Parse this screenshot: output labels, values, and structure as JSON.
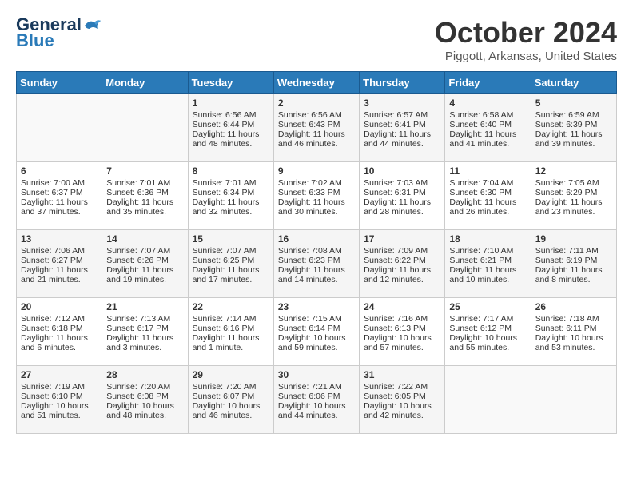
{
  "header": {
    "logo_line1": "General",
    "logo_line2": "Blue",
    "month": "October 2024",
    "location": "Piggott, Arkansas, United States"
  },
  "weekdays": [
    "Sunday",
    "Monday",
    "Tuesday",
    "Wednesday",
    "Thursday",
    "Friday",
    "Saturday"
  ],
  "weeks": [
    [
      {
        "day": "",
        "info": ""
      },
      {
        "day": "",
        "info": ""
      },
      {
        "day": "1",
        "info": "Sunrise: 6:56 AM\nSunset: 6:44 PM\nDaylight: 11 hours and 48 minutes."
      },
      {
        "day": "2",
        "info": "Sunrise: 6:56 AM\nSunset: 6:43 PM\nDaylight: 11 hours and 46 minutes."
      },
      {
        "day": "3",
        "info": "Sunrise: 6:57 AM\nSunset: 6:41 PM\nDaylight: 11 hours and 44 minutes."
      },
      {
        "day": "4",
        "info": "Sunrise: 6:58 AM\nSunset: 6:40 PM\nDaylight: 11 hours and 41 minutes."
      },
      {
        "day": "5",
        "info": "Sunrise: 6:59 AM\nSunset: 6:39 PM\nDaylight: 11 hours and 39 minutes."
      }
    ],
    [
      {
        "day": "6",
        "info": "Sunrise: 7:00 AM\nSunset: 6:37 PM\nDaylight: 11 hours and 37 minutes."
      },
      {
        "day": "7",
        "info": "Sunrise: 7:01 AM\nSunset: 6:36 PM\nDaylight: 11 hours and 35 minutes."
      },
      {
        "day": "8",
        "info": "Sunrise: 7:01 AM\nSunset: 6:34 PM\nDaylight: 11 hours and 32 minutes."
      },
      {
        "day": "9",
        "info": "Sunrise: 7:02 AM\nSunset: 6:33 PM\nDaylight: 11 hours and 30 minutes."
      },
      {
        "day": "10",
        "info": "Sunrise: 7:03 AM\nSunset: 6:31 PM\nDaylight: 11 hours and 28 minutes."
      },
      {
        "day": "11",
        "info": "Sunrise: 7:04 AM\nSunset: 6:30 PM\nDaylight: 11 hours and 26 minutes."
      },
      {
        "day": "12",
        "info": "Sunrise: 7:05 AM\nSunset: 6:29 PM\nDaylight: 11 hours and 23 minutes."
      }
    ],
    [
      {
        "day": "13",
        "info": "Sunrise: 7:06 AM\nSunset: 6:27 PM\nDaylight: 11 hours and 21 minutes."
      },
      {
        "day": "14",
        "info": "Sunrise: 7:07 AM\nSunset: 6:26 PM\nDaylight: 11 hours and 19 minutes."
      },
      {
        "day": "15",
        "info": "Sunrise: 7:07 AM\nSunset: 6:25 PM\nDaylight: 11 hours and 17 minutes."
      },
      {
        "day": "16",
        "info": "Sunrise: 7:08 AM\nSunset: 6:23 PM\nDaylight: 11 hours and 14 minutes."
      },
      {
        "day": "17",
        "info": "Sunrise: 7:09 AM\nSunset: 6:22 PM\nDaylight: 11 hours and 12 minutes."
      },
      {
        "day": "18",
        "info": "Sunrise: 7:10 AM\nSunset: 6:21 PM\nDaylight: 11 hours and 10 minutes."
      },
      {
        "day": "19",
        "info": "Sunrise: 7:11 AM\nSunset: 6:19 PM\nDaylight: 11 hours and 8 minutes."
      }
    ],
    [
      {
        "day": "20",
        "info": "Sunrise: 7:12 AM\nSunset: 6:18 PM\nDaylight: 11 hours and 6 minutes."
      },
      {
        "day": "21",
        "info": "Sunrise: 7:13 AM\nSunset: 6:17 PM\nDaylight: 11 hours and 3 minutes."
      },
      {
        "day": "22",
        "info": "Sunrise: 7:14 AM\nSunset: 6:16 PM\nDaylight: 11 hours and 1 minute."
      },
      {
        "day": "23",
        "info": "Sunrise: 7:15 AM\nSunset: 6:14 PM\nDaylight: 10 hours and 59 minutes."
      },
      {
        "day": "24",
        "info": "Sunrise: 7:16 AM\nSunset: 6:13 PM\nDaylight: 10 hours and 57 minutes."
      },
      {
        "day": "25",
        "info": "Sunrise: 7:17 AM\nSunset: 6:12 PM\nDaylight: 10 hours and 55 minutes."
      },
      {
        "day": "26",
        "info": "Sunrise: 7:18 AM\nSunset: 6:11 PM\nDaylight: 10 hours and 53 minutes."
      }
    ],
    [
      {
        "day": "27",
        "info": "Sunrise: 7:19 AM\nSunset: 6:10 PM\nDaylight: 10 hours and 51 minutes."
      },
      {
        "day": "28",
        "info": "Sunrise: 7:20 AM\nSunset: 6:08 PM\nDaylight: 10 hours and 48 minutes."
      },
      {
        "day": "29",
        "info": "Sunrise: 7:20 AM\nSunset: 6:07 PM\nDaylight: 10 hours and 46 minutes."
      },
      {
        "day": "30",
        "info": "Sunrise: 7:21 AM\nSunset: 6:06 PM\nDaylight: 10 hours and 44 minutes."
      },
      {
        "day": "31",
        "info": "Sunrise: 7:22 AM\nSunset: 6:05 PM\nDaylight: 10 hours and 42 minutes."
      },
      {
        "day": "",
        "info": ""
      },
      {
        "day": "",
        "info": ""
      }
    ]
  ]
}
